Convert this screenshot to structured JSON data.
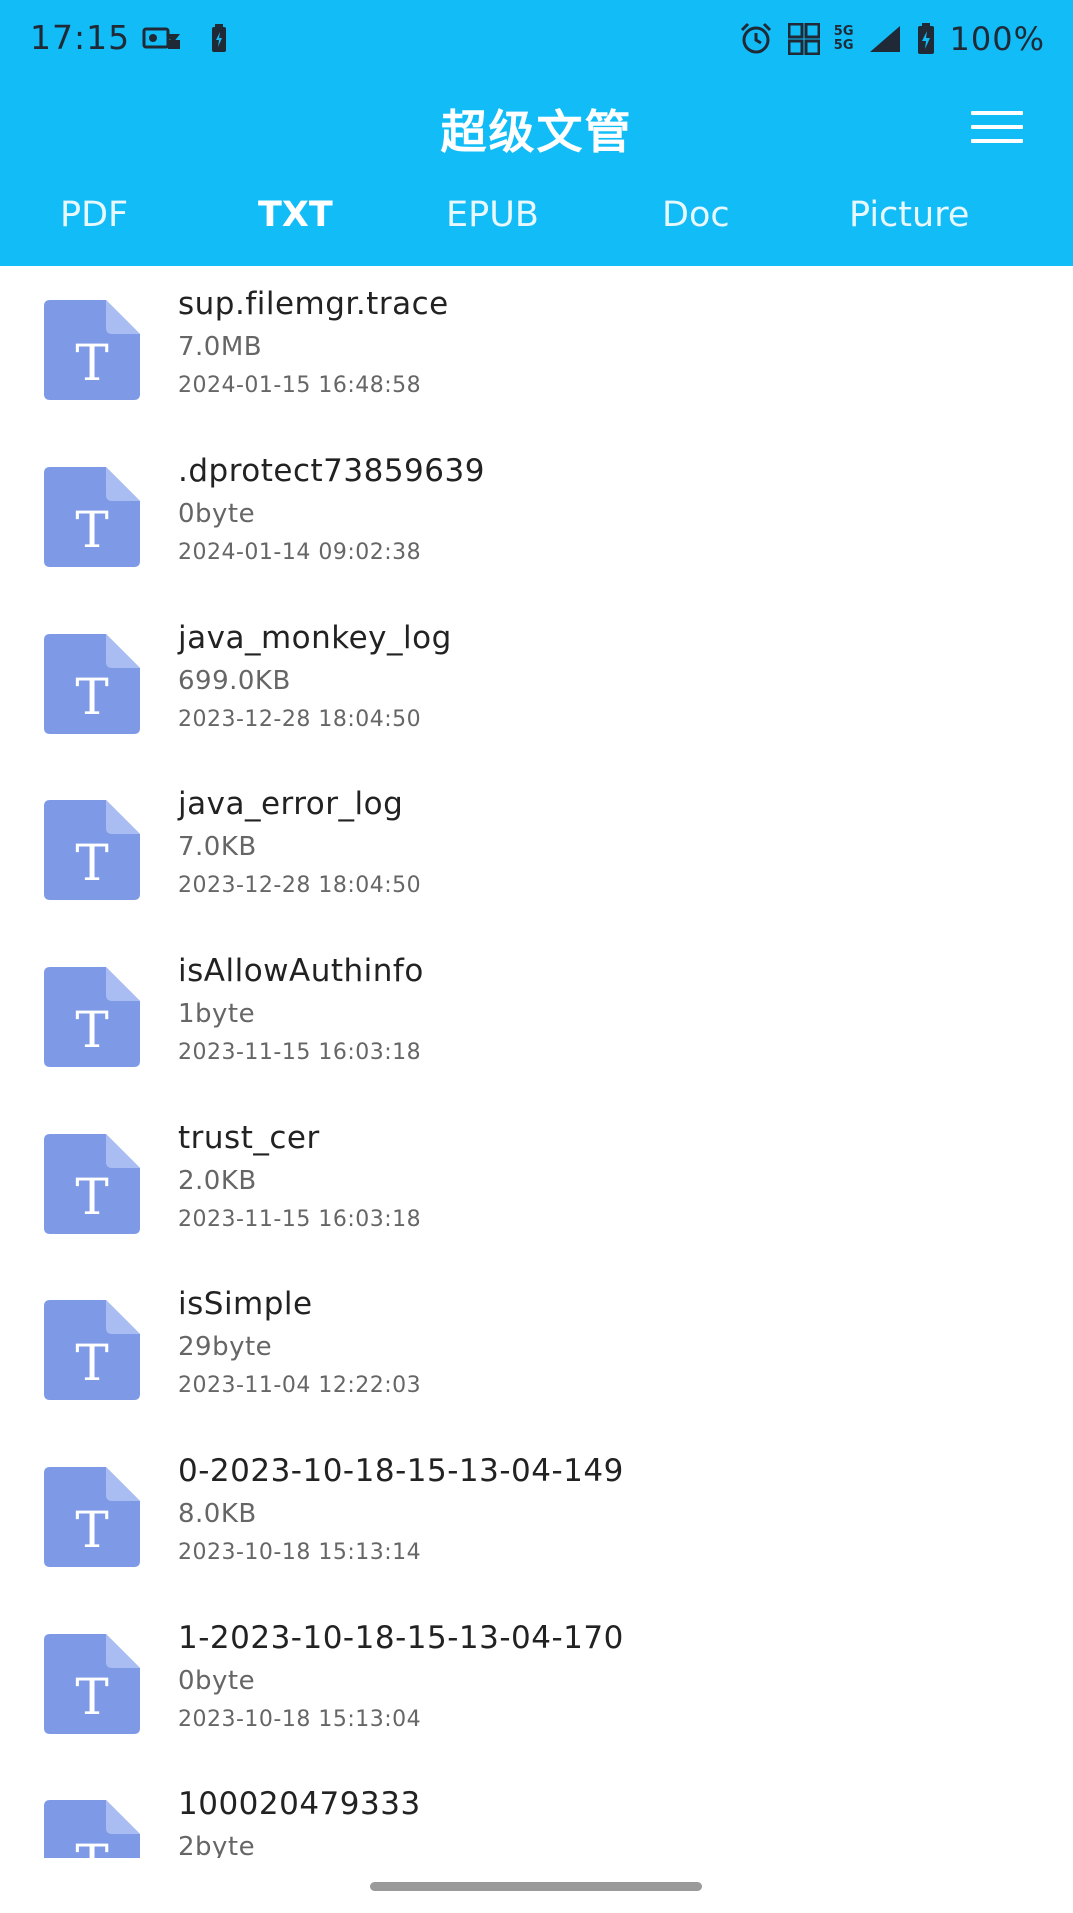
{
  "status_bar": {
    "time": "17:15",
    "battery_text": "100%",
    "network_label_top": "5G",
    "network_label_bottom": "5G",
    "icons": [
      "message-icon",
      "battery-saver-icon",
      "alarm-icon",
      "hd-icon",
      "signal-icon",
      "battery-icon"
    ]
  },
  "header": {
    "title": "超级文管",
    "menu_icon": "hamburger-menu-icon"
  },
  "tabs": [
    {
      "label": "PDF",
      "active": false
    },
    {
      "label": "TXT",
      "active": true
    },
    {
      "label": "EPUB",
      "active": false
    },
    {
      "label": "Doc",
      "active": false
    },
    {
      "label": "Picture",
      "active": false
    }
  ],
  "file_icon_letter": "T",
  "files": [
    {
      "name": "sup.filemgr.trace",
      "size": "7.0MB",
      "date": "2024-01-15 16:48:58"
    },
    {
      "name": ".dprotect73859639",
      "size": "0byte",
      "date": "2024-01-14 09:02:38"
    },
    {
      "name": "java_monkey_log",
      "size": "699.0KB",
      "date": "2023-12-28 18:04:50"
    },
    {
      "name": "java_error_log",
      "size": "7.0KB",
      "date": "2023-12-28 18:04:50"
    },
    {
      "name": "isAllowAuthinfo",
      "size": "1byte",
      "date": "2023-11-15 16:03:18"
    },
    {
      "name": "trust_cer",
      "size": "2.0KB",
      "date": "2023-11-15 16:03:18"
    },
    {
      "name": "isSimple",
      "size": "29byte",
      "date": "2023-11-04 12:22:03"
    },
    {
      "name": "0-2023-10-18-15-13-04-149",
      "size": "8.0KB",
      "date": "2023-10-18 15:13:14"
    },
    {
      "name": "1-2023-10-18-15-13-04-170",
      "size": "0byte",
      "date": "2023-10-18 15:13:04"
    },
    {
      "name": "100020479333",
      "size": "2byte",
      "date": ""
    }
  ],
  "colors": {
    "header_bg": "#12bcf7",
    "file_icon_fill": "#7e9ae6",
    "file_icon_fold": "#a9bdf2"
  }
}
